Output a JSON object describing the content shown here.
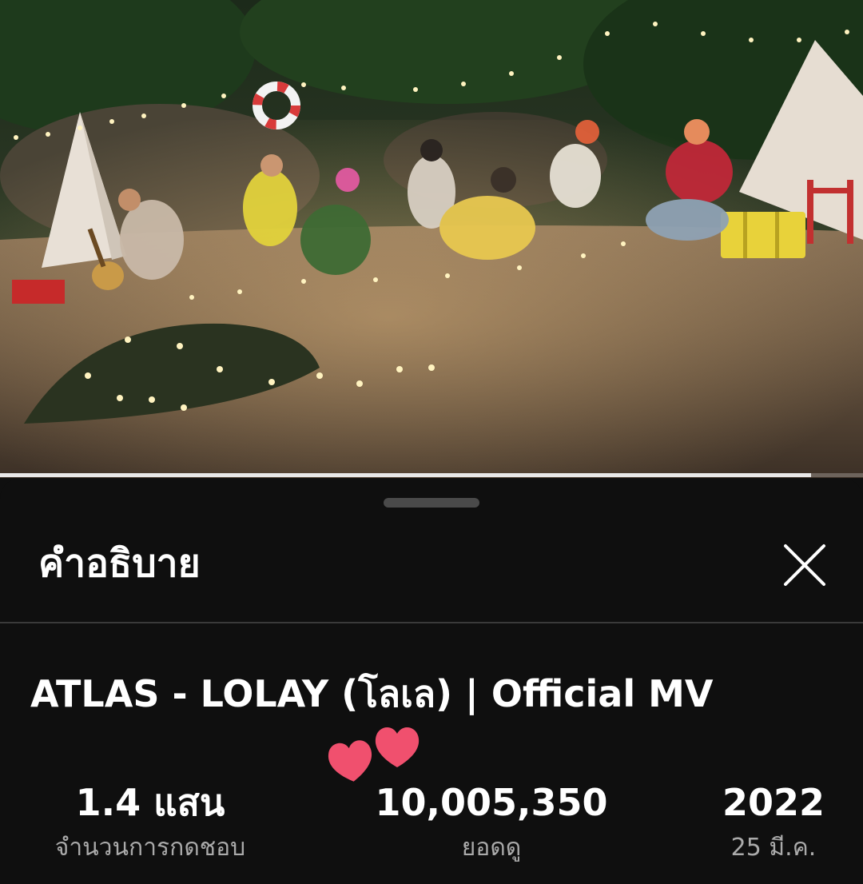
{
  "player": {
    "progress_fraction": 0.94
  },
  "description_sheet": {
    "header_title": "คำอธิบาย",
    "close_icon": "close-icon",
    "video_title": "ATLAS - LOLAY (โลเล) | Official MV",
    "stats": {
      "likes_value": "1.4 แสน",
      "likes_label": "จำนวนการกดชอบ",
      "views_value": "10,005,350",
      "views_label": "ยอดดู",
      "year_value": "2022",
      "date_label": "25 มี.ค."
    },
    "decoration_icon": "hearts-icon"
  },
  "colors": {
    "background": "#0f0f0f",
    "heart": "#f0506e",
    "secondary_text": "#aaaaaa"
  }
}
